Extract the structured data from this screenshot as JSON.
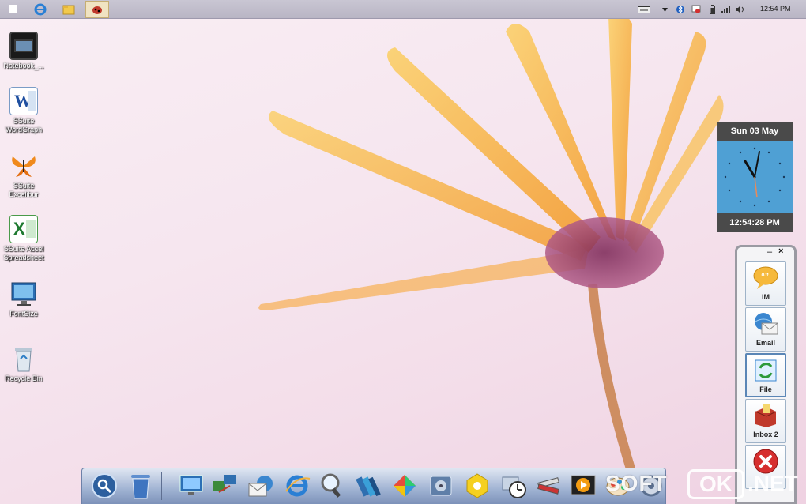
{
  "taskbar": {
    "pinned": [
      {
        "name": "start-button",
        "icon": "windows-logo-icon"
      },
      {
        "name": "internet-explorer",
        "icon": "ie-icon"
      },
      {
        "name": "file-explorer",
        "icon": "folder-icon"
      },
      {
        "name": "active-app",
        "icon": "ladybug-icon"
      }
    ],
    "tray": {
      "keyboard_icon": "keyboard-icon",
      "clock": "12:54 PM"
    }
  },
  "desktop": {
    "icons": [
      {
        "label": "Notebook_...",
        "icon": "notebook-video-icon"
      },
      {
        "label": "SSuite WordGraph",
        "icon": "word-document-icon"
      },
      {
        "label": "SSuite Excalibur",
        "icon": "butterfly-icon"
      },
      {
        "label": "SSuite Accel Spreadsheet",
        "icon": "spreadsheet-icon"
      },
      {
        "label": "FontSize",
        "icon": "monitor-font-icon"
      },
      {
        "label": "Recycle Bin",
        "icon": "recycle-bin-icon"
      }
    ]
  },
  "gadget_clock": {
    "date": "Sun  03 May",
    "time": "12:54:28 PM"
  },
  "side_panel": {
    "minimize": "–",
    "close": "×",
    "buttons": [
      {
        "label": "IM",
        "icon": "speech-bubble-icon"
      },
      {
        "label": "Email",
        "icon": "email-globe-icon"
      },
      {
        "label": "File",
        "icon": "file-transfer-icon"
      },
      {
        "label": "Inbox 2",
        "icon": "inbox-box-icon"
      },
      {
        "label": "",
        "icon": "close-red-icon"
      }
    ]
  },
  "dock": {
    "items": [
      "search-icon",
      "trash-icon",
      "computer-icon",
      "network-icon",
      "mail-icon",
      "internet-icon",
      "magnifier-icon",
      "books-icon",
      "windows-update-icon",
      "disk-icon",
      "gallery-icon",
      "clock-icon",
      "tools-icon",
      "media-player-icon",
      "paint-icon",
      "settings-icon"
    ]
  },
  "watermark": {
    "soft": "SOFT",
    "ok": "OK",
    "net": ".NET"
  },
  "colors": {
    "taskbar": "#c2bfcc",
    "gadget_face": "#4fa0d4",
    "dock": "#9fb2d2",
    "petal": "#f6a93a"
  }
}
